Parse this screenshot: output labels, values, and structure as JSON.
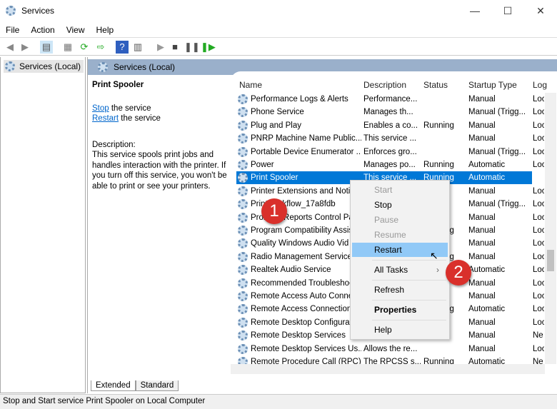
{
  "window": {
    "title": "Services",
    "minimize": "—",
    "maximize": "☐",
    "close": "✕"
  },
  "menu": [
    "File",
    "Action",
    "View",
    "Help"
  ],
  "tree": {
    "item": "Services (Local)"
  },
  "panel": {
    "header": "Services (Local)",
    "selected_title": "Print Spooler",
    "stop_link": "Stop",
    "stop_rest": " the service",
    "restart_link": "Restart",
    "restart_rest": " the service",
    "description_label": "Description:",
    "description": "This service spools print jobs and handles interaction with the printer. If you turn off this service, you won't be able to print or see your printers."
  },
  "columns": [
    "Name",
    "Description",
    "Status",
    "Startup Type",
    "Log"
  ],
  "rows": [
    [
      "Performance Logs & Alerts",
      "Performance...",
      "",
      "Manual",
      "Loc"
    ],
    [
      "Phone Service",
      "Manages th...",
      "",
      "Manual (Trigg...",
      "Loc"
    ],
    [
      "Plug and Play",
      "Enables a co...",
      "Running",
      "Manual",
      "Loc"
    ],
    [
      "PNRP Machine Name Public...",
      "This service ...",
      "",
      "Manual",
      "Loc"
    ],
    [
      "Portable Device Enumerator ...",
      "Enforces gro...",
      "",
      "Manual (Trigg...",
      "Loc"
    ],
    [
      "Power",
      "Manages po...",
      "Running",
      "Automatic",
      "Loc"
    ],
    [
      "Print Spooler",
      "This service ...",
      "Running",
      "Automatic",
      "Loc"
    ],
    [
      "Printer Extensions and Notif",
      "",
      "",
      "Manual",
      "Loc"
    ],
    [
      "PrintWorkflow_17a8fdb",
      "",
      "",
      "Manual (Trigg...",
      "Loc"
    ],
    [
      "Problem Reports Control Pa",
      "",
      "",
      "Manual",
      "Loc"
    ],
    [
      "Program Compatibility Assis",
      "",
      "Running",
      "Manual",
      "Loc"
    ],
    [
      "Quality Windows Audio Vid",
      "",
      "",
      "Manual",
      "Loc"
    ],
    [
      "Radio Management Service",
      "",
      "Running",
      "Manual",
      "Loc"
    ],
    [
      "Realtek Audio Service",
      "",
      "",
      "Automatic",
      "Loc"
    ],
    [
      "Recommended Troubleshoo",
      "",
      "",
      "Manual",
      "Loc"
    ],
    [
      "Remote Access Auto Connec",
      "",
      "",
      "Manual",
      "Loc"
    ],
    [
      "Remote Access Connection ...",
      "",
      "Running",
      "Automatic",
      "Loc"
    ],
    [
      "Remote Desktop Configurat",
      "",
      "",
      "Manual",
      "Loc"
    ],
    [
      "Remote Desktop Services",
      "",
      "",
      "Manual",
      "Ne"
    ],
    [
      "Remote Desktop Services Us...",
      "Allows the re...",
      "",
      "Manual",
      "Loc"
    ],
    [
      "Remote Procedure Call (RPC)",
      "The RPCSS s...",
      "Running",
      "Automatic",
      "Ne"
    ]
  ],
  "selected_row": 6,
  "context_menu": [
    {
      "label": "Start",
      "state": "disabled"
    },
    {
      "label": "Stop",
      "state": "normal"
    },
    {
      "label": "Pause",
      "state": "disabled"
    },
    {
      "label": "Resume",
      "state": "disabled"
    },
    {
      "label": "Restart",
      "state": "highlighted"
    },
    {
      "label": "All Tasks",
      "state": "submenu"
    },
    {
      "label": "Refresh",
      "state": "normal"
    },
    {
      "label": "Properties",
      "state": "bold"
    },
    {
      "label": "Help",
      "state": "normal"
    }
  ],
  "tabs": [
    "Extended",
    "Standard"
  ],
  "status_bar": "Stop and Start service Print Spooler on Local Computer",
  "annotations": [
    "1",
    "2"
  ],
  "colors": {
    "selection": "#0078d7",
    "menu_highlight": "#91c9f7",
    "header": "#9ab0cb",
    "badge": "#d9302b"
  }
}
